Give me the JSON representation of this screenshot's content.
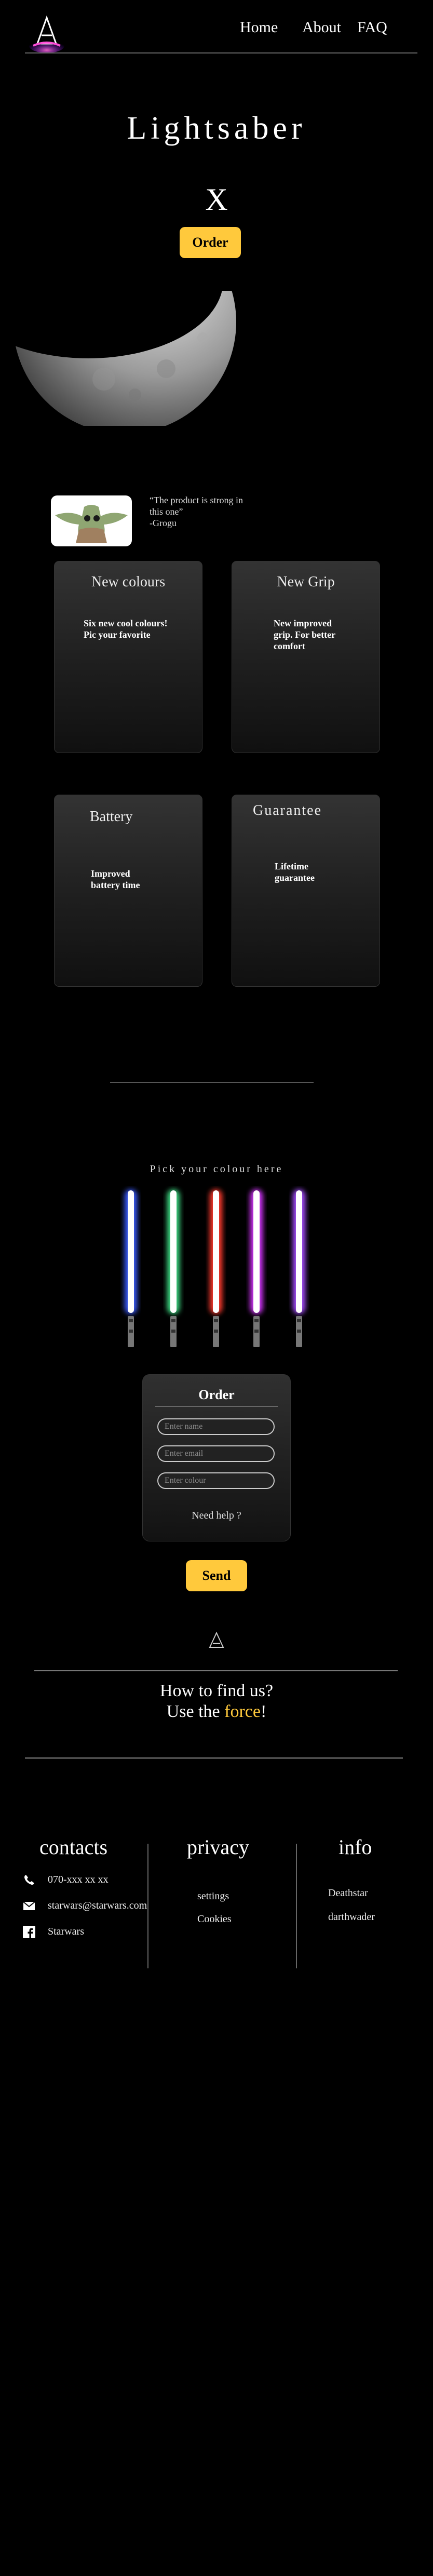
{
  "header": {
    "nav": [
      "Home",
      "About",
      "FAQ"
    ]
  },
  "hero": {
    "title": "Lightsaber",
    "close_glyph": "X",
    "order_label": "Order"
  },
  "testimonial": {
    "quote": "“The product is strong in this one”",
    "author": "-Grogu"
  },
  "features": [
    {
      "title": "New colours",
      "text": "Six new cool colours! Pic your favorite"
    },
    {
      "title": "New Grip",
      "text": "New improved grip. For better comfort"
    },
    {
      "title": "Battery",
      "text": "Improved battery time"
    },
    {
      "title": "Guarantee",
      "text": "Lifetime guarantee"
    }
  ],
  "colour_picker": {
    "label": "Pick your colour here",
    "colours": [
      "#3b5bff",
      "#3ddc84",
      "#ff3b2f",
      "#d535ff",
      "#a64dff"
    ]
  },
  "order_form": {
    "title": "Order",
    "name_placeholder": "Enter name",
    "email_placeholder": "Enter email",
    "colour_placeholder": "Enter colour",
    "help": "Need help ?",
    "send_label": "Send"
  },
  "find_us": {
    "line1": "How to find us?",
    "line2_prefix": "Use the ",
    "line2_highlight": "force",
    "line2_suffix": "!"
  },
  "footer": {
    "contacts": {
      "title": "contacts",
      "phone": "070-xxx xx xx",
      "email": "starwars@starwars.com",
      "facebook": "Starwars"
    },
    "privacy": {
      "title": "privacy",
      "items": [
        "settings",
        "Cookies"
      ]
    },
    "info": {
      "title": "info",
      "items": [
        "Deathstar",
        "darthwader"
      ]
    }
  },
  "colors": {
    "accent": "#ffc93c",
    "background": "#000000"
  }
}
